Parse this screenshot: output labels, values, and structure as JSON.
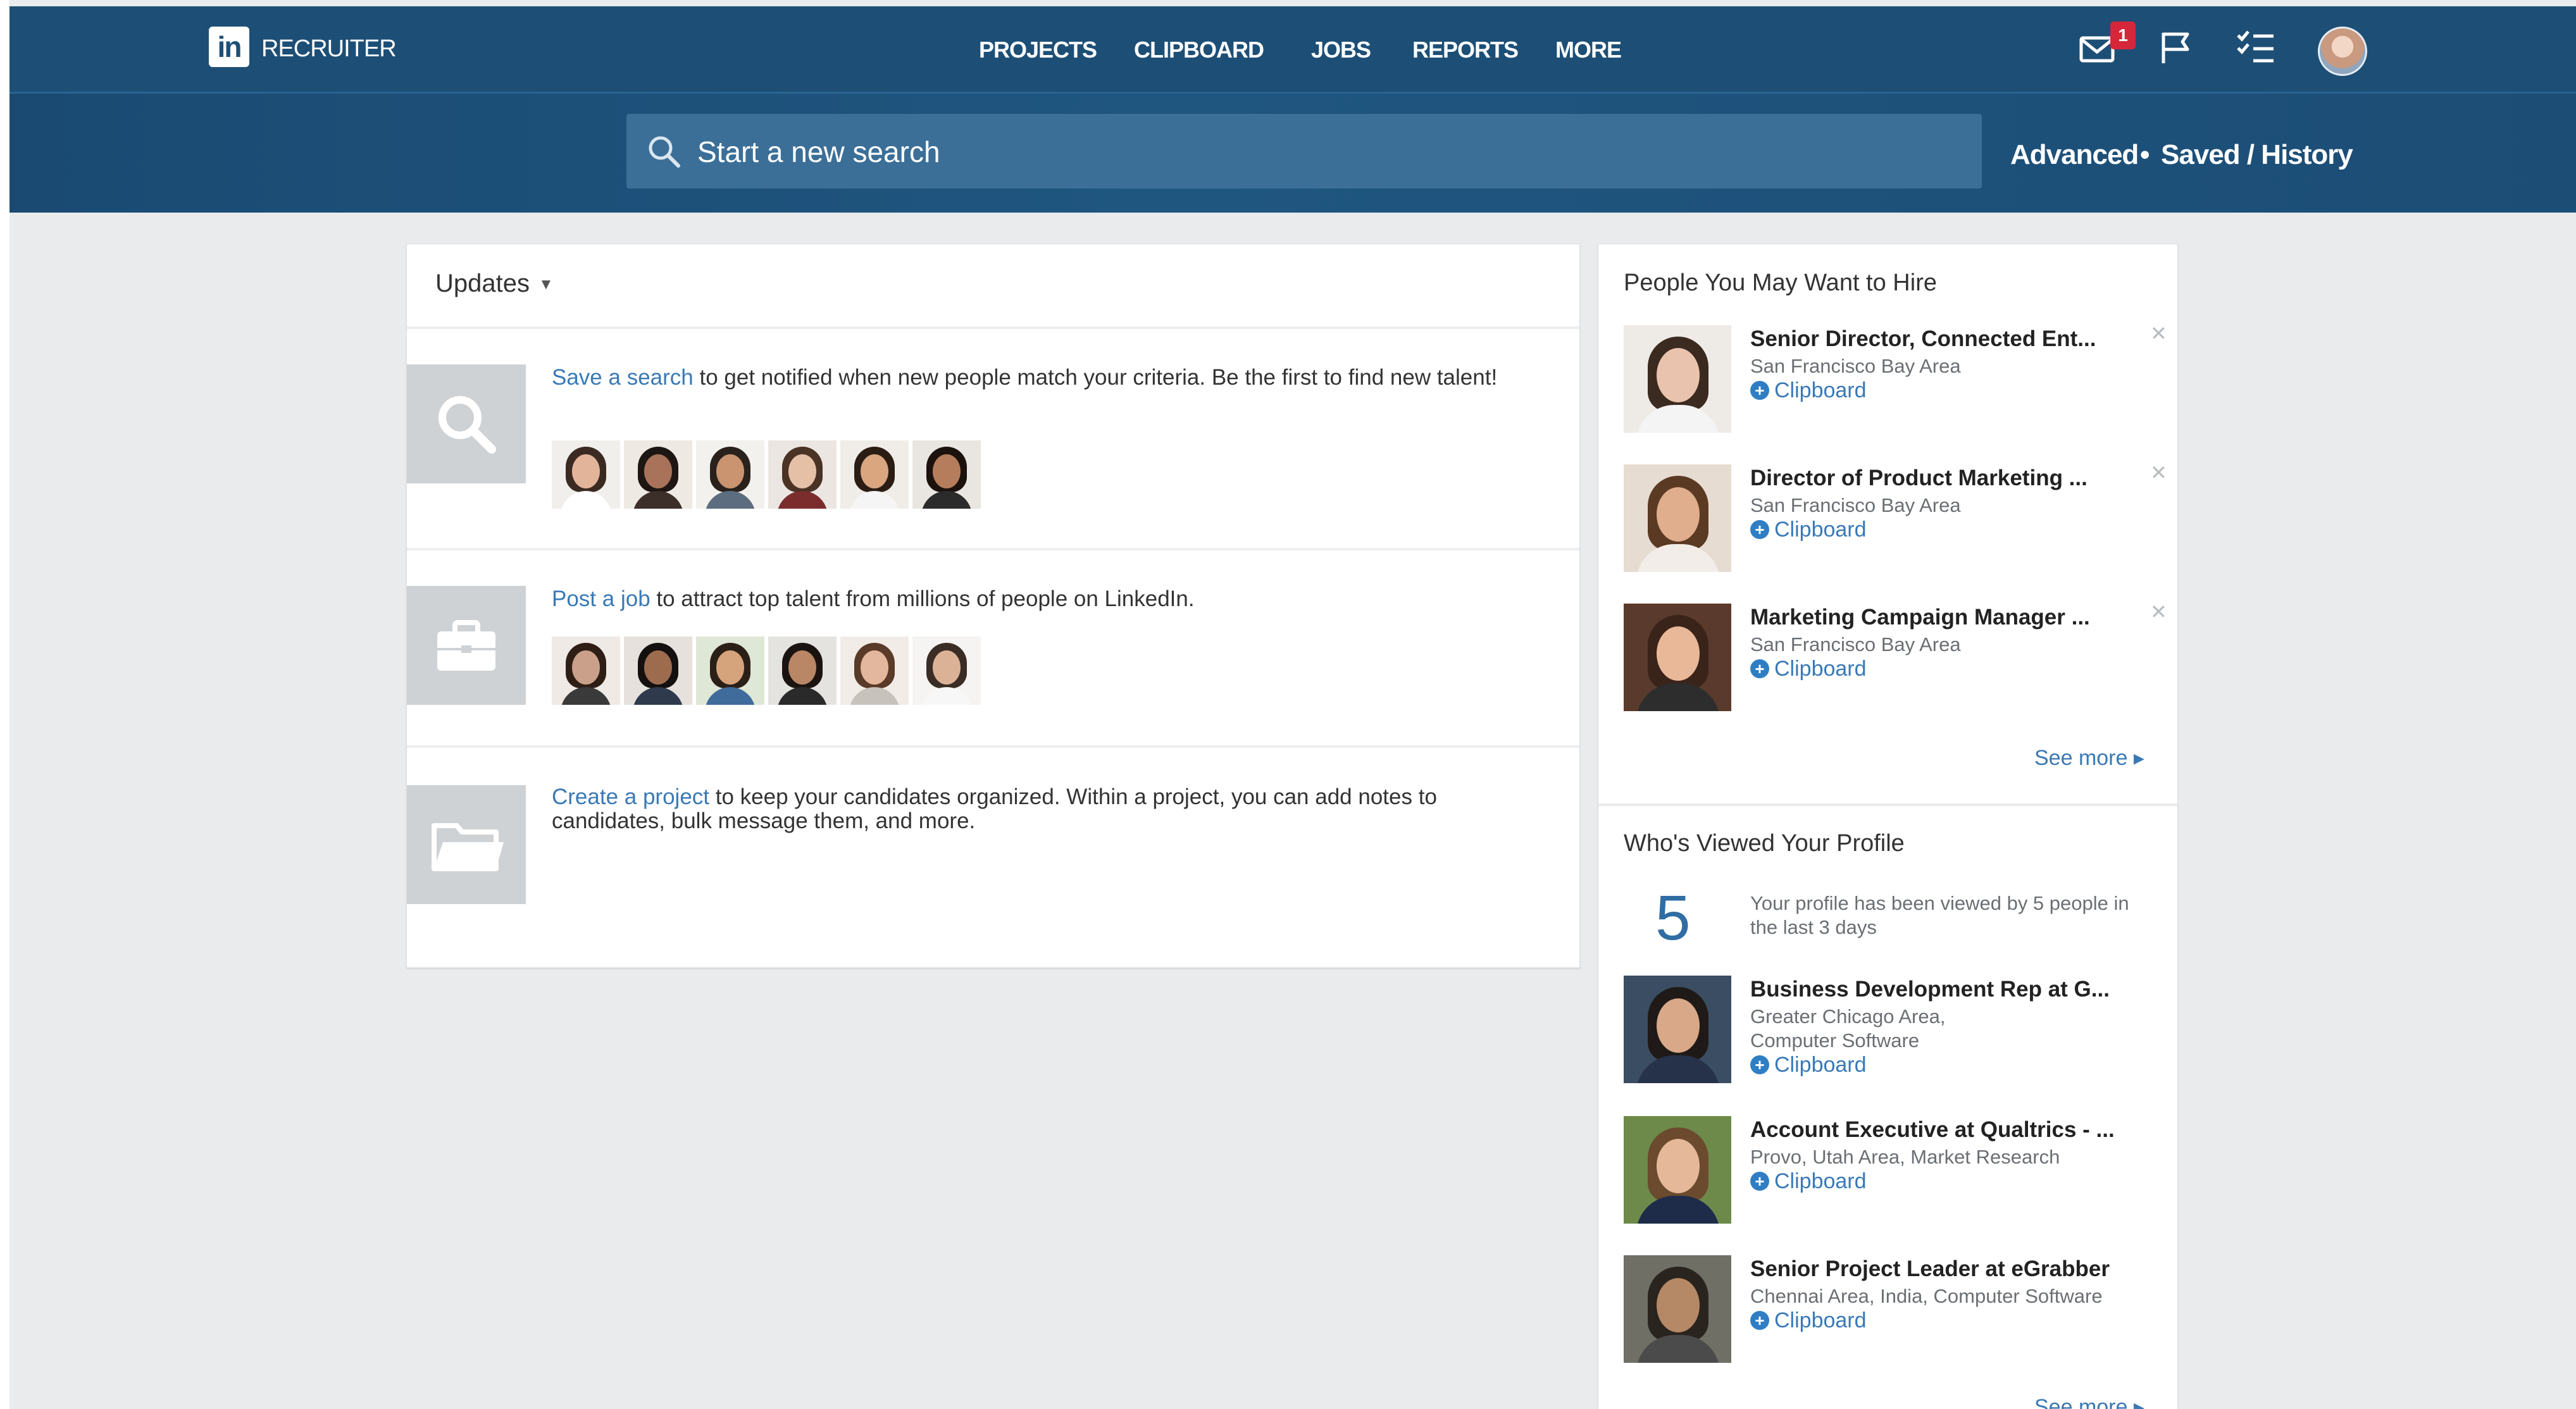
{
  "header": {
    "logo_mark": "in",
    "logo_text": "RECRUITER",
    "nav": [
      "PROJECTS",
      "CLIPBOARD",
      "JOBS",
      "REPORTS",
      "MORE"
    ],
    "notification_count": "1",
    "icons": [
      "mail-icon",
      "flag-icon",
      "checklist-icon",
      "user-avatar"
    ],
    "colors": {
      "nav_bar": "#1d4f76",
      "search_bar": "#1c4d75",
      "link": "#3a79b6",
      "badge": "#d6263a"
    }
  },
  "search": {
    "placeholder": "Start a new search",
    "advanced_label": "Advanced",
    "separator": "•",
    "saved_label": "Saved / History"
  },
  "updates": {
    "title": "Updates",
    "items": [
      {
        "icon": "search-icon",
        "link_text": "Save a search",
        "text": " to get notified when new people match your criteria. Be the first to find new talent!"
      },
      {
        "icon": "briefcase-icon",
        "link_text": "Post a job",
        "text": " to attract top talent from millions of people on LinkedIn."
      },
      {
        "icon": "folder-icon",
        "link_text": "Create a project",
        "text": " to keep your candidates organized. Within a project, you can add notes to candidates, bulk message them, and more."
      }
    ]
  },
  "hire": {
    "heading": "People You May Want to Hire",
    "people": [
      {
        "title": "Senior Director, Connected Ent...",
        "location": "San Francisco Bay Area",
        "clipboard": "Clipboard"
      },
      {
        "title": "Director of Product Marketing ...",
        "location": "San Francisco Bay Area",
        "clipboard": "Clipboard"
      },
      {
        "title": "Marketing Campaign Manager ...",
        "location": "San Francisco Bay Area",
        "clipboard": "Clipboard"
      }
    ],
    "see_more": "See more ▸"
  },
  "viewed": {
    "heading": "Who's Viewed Your Profile",
    "count": "5",
    "summary": "Your profile has been viewed by 5 people in the last 3 days",
    "people": [
      {
        "title": "Business Development Rep at G...",
        "location": "Greater Chicago Area, Computer Software",
        "clipboard": "Clipboard"
      },
      {
        "title": "Account Executive at Qualtrics - ...",
        "location": "Provo, Utah Area, Market Research",
        "clipboard": "Clipboard"
      },
      {
        "title": "Senior Project Leader at eGrabber",
        "location": "Chennai Area, India, Computer Software",
        "clipboard": "Clipboard"
      }
    ],
    "see_more": "See more ▸"
  }
}
